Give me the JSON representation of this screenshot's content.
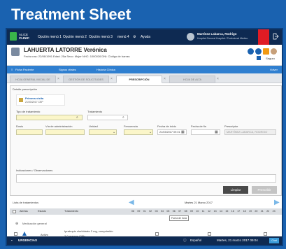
{
  "banner": {
    "title": "Treatment Sheet"
  },
  "topbar": {
    "logo_text_line1": "ALICE",
    "logo_text_line2": "CLINIC",
    "menus": [
      "Opción menú 1",
      "Opción menú 2",
      "Opción menú 3",
      "menú 4",
      "Ayuda"
    ],
    "user_name": "Martínez Labarca, Rodrigo",
    "user_role": "Hospital General Hospital / Profesional Médico"
  },
  "patient": {
    "name": "LAHUERTA LATORRE Verónica",
    "info": "Fecha nac: 22/06/1991   Edad: 25a   Sexo: Mujer   NHC: 1000026   DNI:        Código de barras:",
    "seguro": "Seguro"
  },
  "toolbar": {
    "items": [
      "Ficha Paciente",
      "Signos vitales",
      "Historia Clínica"
    ],
    "right": "Volver"
  },
  "tabs": [
    {
      "label": "HOJA GENERAL INICIAL DE URGENCIAS",
      "active": false
    },
    {
      "label": "GESTIÓN DE SOLICITUDES",
      "active": false
    },
    {
      "label": "PRESCRIPCIÓN",
      "active": true
    },
    {
      "label": "HOJA DE ALTA",
      "active": false
    }
  ],
  "prescription": {
    "section_title": "Detalle prescripción",
    "card_title": "Primera visita",
    "card_date": "21/03/2017    CEP",
    "labels": {
      "tipo": "Tipo de tratamiento",
      "tratamiento": "Tratamiento",
      "dosis": "Dosis",
      "via": "Vía de administración",
      "unidad": "Unidad",
      "frecuencia": "Frecuencia",
      "fecha_inicio": "Fecha de inicio",
      "fecha_fin": "Fecha de fin",
      "prescriptor": "Prescriptor",
      "indicaciones": "Indicaciones / Observaciones"
    },
    "values": {
      "fecha_inicio": "21/03/2017 09:01",
      "prescriptor": "MARTÍNEZ LABARCA, RODRIGO"
    },
    "buttons": {
      "primary": "Limpiar",
      "secondary": "Prescribir"
    }
  },
  "list": {
    "title": "Lista de tratamientos",
    "date": "Martes 21 Marzo 2017",
    "headers": [
      "Alertas",
      "Estado",
      "Tratamiento"
    ],
    "hours": [
      "08",
      "09",
      "01",
      "02",
      "03",
      "04",
      "05",
      "06",
      "07",
      "08",
      "09",
      "10",
      "11",
      "12",
      "13",
      "14",
      "15",
      "16",
      "17",
      "18",
      "19",
      "20",
      "21",
      "22",
      "23"
    ],
    "tooltip": "Fuera de hora",
    "group": "Medicación general",
    "row": {
      "estado": "Activo",
      "tratamiento_line1": "Ipratropio clorhidrato 2 mg, comprimido",
      "tratamiento_line2": "2.0 gramos C/8h"
    }
  },
  "footer": {
    "left": "URGENCIAS",
    "language": "Español",
    "datetime": "Martes, 21 marzo 2017 09:04",
    "chat": "Chat"
  }
}
